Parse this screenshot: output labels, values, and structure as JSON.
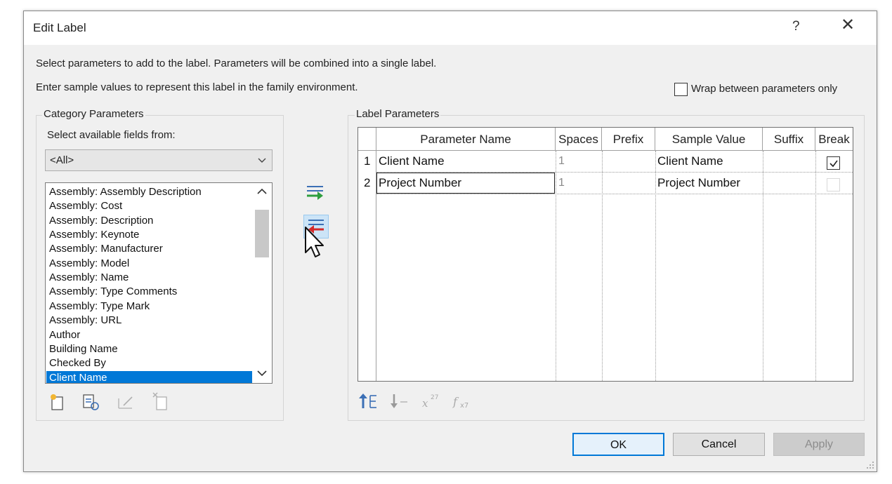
{
  "dialog": {
    "title": "Edit Label",
    "help_label": "?",
    "close_label": "✕"
  },
  "instructions": {
    "line1": "Select parameters to add to the label.  Parameters will be combined into a single label.",
    "line2": "Enter sample values to represent this label in the family environment."
  },
  "wrap_option": {
    "label": "Wrap between parameters only",
    "checked": false
  },
  "category_parameters": {
    "group_label": "Category Parameters",
    "select_label": "Select available fields from:",
    "selected_value": "<All>",
    "items": [
      "Assembly: Assembly Description",
      "Assembly: Cost",
      "Assembly: Description",
      "Assembly: Keynote",
      "Assembly: Manufacturer",
      "Assembly: Model",
      "Assembly: Name",
      "Assembly: Type Comments",
      "Assembly: Type Mark",
      "Assembly: URL",
      "Author",
      "Building Name",
      "Checked By",
      "Client Name"
    ],
    "selected_item": "Client Name"
  },
  "label_parameters": {
    "group_label": "Label Parameters",
    "columns": [
      "Parameter Name",
      "Spaces",
      "Prefix",
      "Sample Value",
      "Suffix",
      "Break"
    ],
    "rows": [
      {
        "num": "1",
        "name": "Client Name",
        "spaces": "1",
        "prefix": "",
        "sample": "Client Name",
        "suffix": "",
        "break": true
      },
      {
        "num": "2",
        "name": "Project Number",
        "spaces": "1",
        "prefix": "",
        "sample": "Project Number",
        "suffix": "",
        "break": false
      }
    ]
  },
  "buttons": {
    "ok": "OK",
    "cancel": "Cancel",
    "apply": "Apply"
  },
  "colors": {
    "selection": "#0078d7",
    "add_arrow": "#2e9e3e",
    "remove_arrow": "#d42a2a",
    "toolbar_blue": "#3b6fb5"
  }
}
